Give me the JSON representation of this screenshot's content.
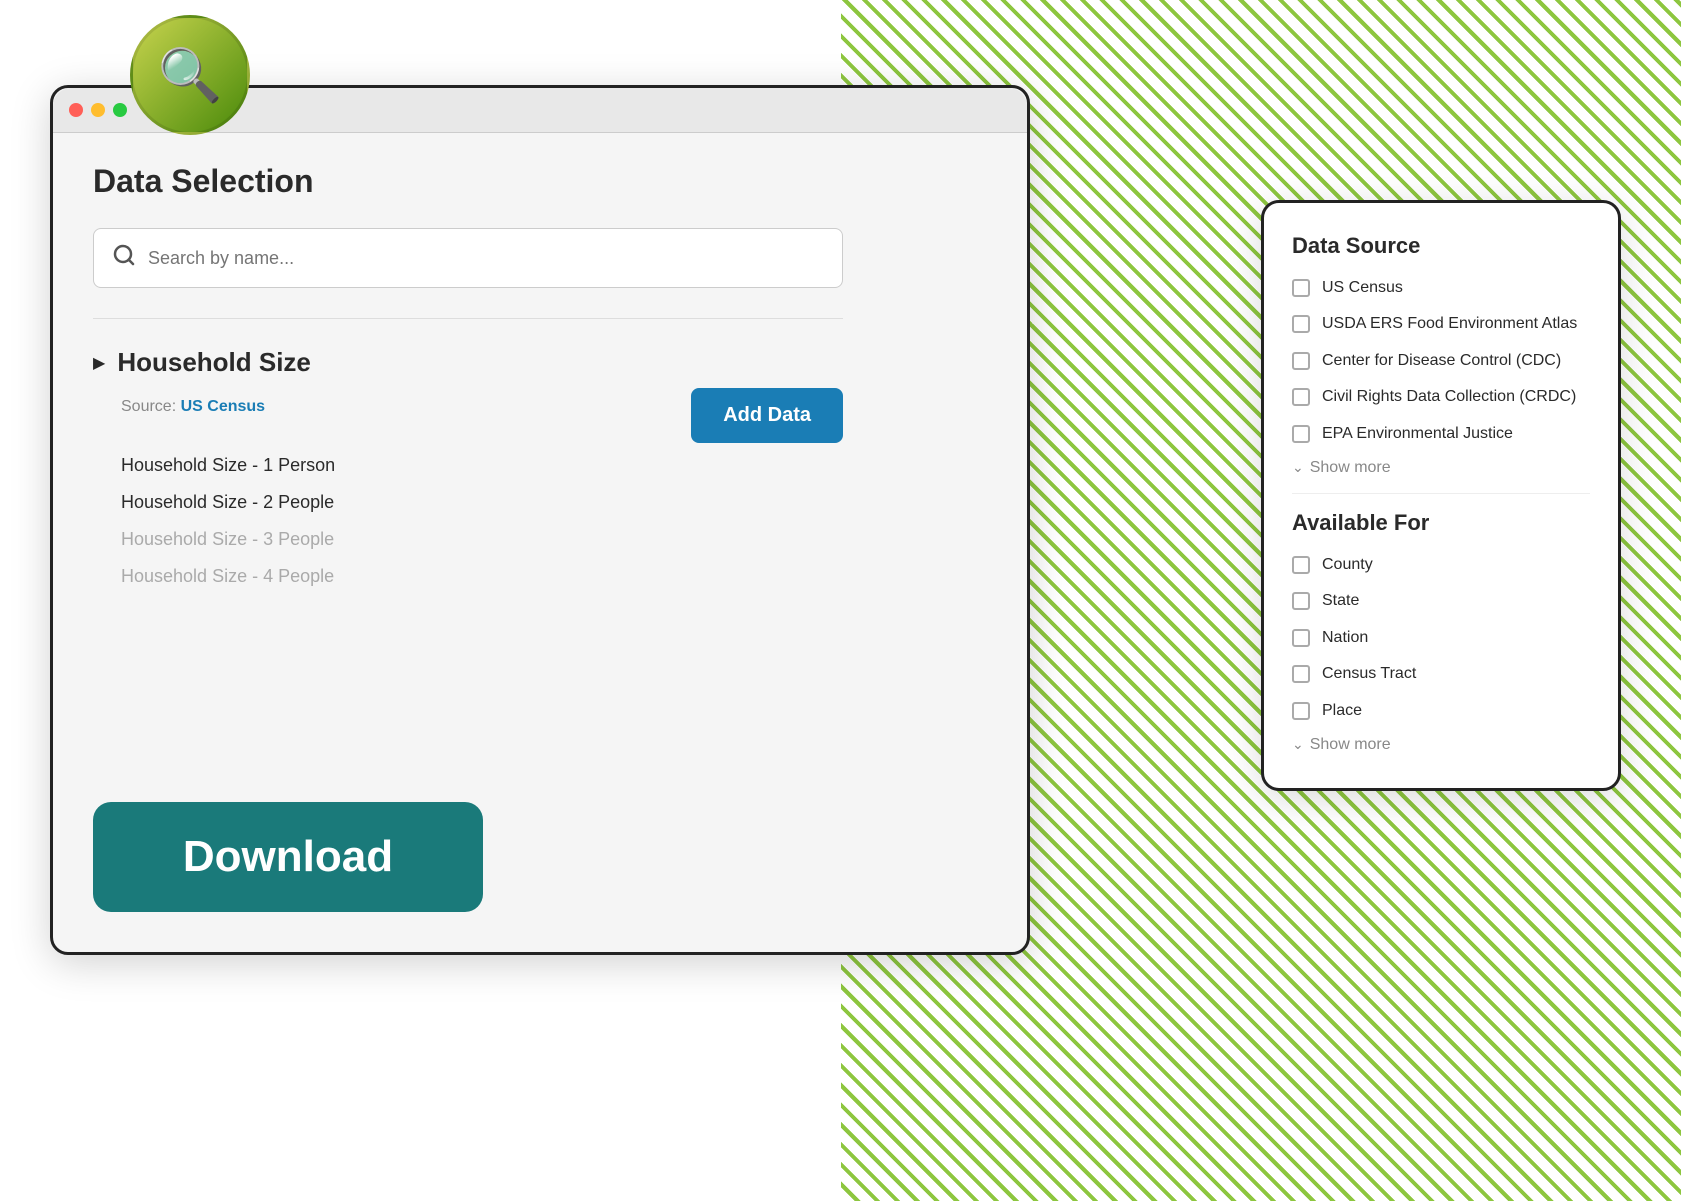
{
  "page": {
    "title": "Data Selection"
  },
  "search": {
    "placeholder": "Search by name..."
  },
  "window_controls": {
    "dot_red": "close",
    "dot_yellow": "minimize",
    "dot_green": "maximize"
  },
  "data_item": {
    "title": "Household Size",
    "source_prefix": "Source:",
    "source_name": "US Census",
    "add_button_label": "Add Data",
    "sub_items": [
      {
        "label": "Household Size - 1 Person",
        "faded": false
      },
      {
        "label": "Household Size - 2 People",
        "faded": false
      },
      {
        "label": "Household Size - 3 People",
        "faded": true
      },
      {
        "label": "Household Size - 4 People",
        "faded": true
      }
    ]
  },
  "download_button": {
    "label": "Download"
  },
  "filter_panel": {
    "data_source_title": "Data Source",
    "data_sources": [
      {
        "label": "US Census"
      },
      {
        "label": "USDA ERS Food Environment Atlas"
      },
      {
        "label": "Center for Disease Control (CDC)"
      },
      {
        "label": "Civil Rights Data Collection (CRDC)"
      },
      {
        "label": "EPA Environmental Justice"
      }
    ],
    "data_source_show_more": "Show more",
    "available_for_title": "Available For",
    "available_for": [
      {
        "label": "County"
      },
      {
        "label": "State"
      },
      {
        "label": "Nation"
      },
      {
        "label": "Census Tract"
      },
      {
        "label": "Place"
      }
    ],
    "available_for_show_more": "Show more"
  }
}
